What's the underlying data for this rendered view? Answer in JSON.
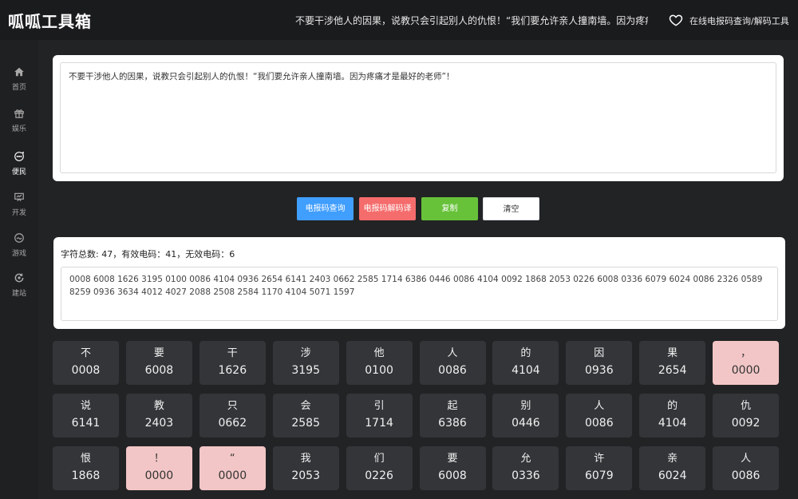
{
  "header": {
    "logo": "呱呱工具箱",
    "marquee": "不要干涉他人的因果，说教只会引起别人的仇恨！“我们要允许亲人撞南墙。因为疼痛才是:",
    "link": "在线电报码查询/解码工具"
  },
  "sidebar": {
    "items": [
      {
        "label": "首页",
        "icon": "home-icon"
      },
      {
        "label": "娱乐",
        "icon": "gift-icon"
      },
      {
        "label": "便民",
        "icon": "chat-icon"
      },
      {
        "label": "开发",
        "icon": "presentation-icon"
      },
      {
        "label": "游戏",
        "icon": "gamepad-icon"
      },
      {
        "label": "建站",
        "icon": "refresh-icon"
      }
    ],
    "active": "便民"
  },
  "input": {
    "value": "不要干涉他人的因果，说教只会引起别人的仇恨！“我们要允许亲人撞南墙。因为疼痛才是最好的老师”！"
  },
  "buttons": {
    "query": "电报码查询",
    "decode": "电报码解码译",
    "copy": "复制",
    "clear": "清空"
  },
  "result": {
    "summary": "字符总数: 47，有效电码：41，无效电码：6",
    "codes": "0008 6008 1626 3195 0100 0086 4104 0936 2654 6141 2403 0662 2585 1714 6386 0446 0086 4104 0092 1868 2053 0226 6008 0336 6079 6024 0086 2326 0589 8259 0936 3634 4012 4027 2088 2508 2584 1170 4104 5071 1597"
  },
  "cells": [
    {
      "ch": "不",
      "code": "0008",
      "invalid": false
    },
    {
      "ch": "要",
      "code": "6008",
      "invalid": false
    },
    {
      "ch": "干",
      "code": "1626",
      "invalid": false
    },
    {
      "ch": "涉",
      "code": "3195",
      "invalid": false
    },
    {
      "ch": "他",
      "code": "0100",
      "invalid": false
    },
    {
      "ch": "人",
      "code": "0086",
      "invalid": false
    },
    {
      "ch": "的",
      "code": "4104",
      "invalid": false
    },
    {
      "ch": "因",
      "code": "0936",
      "invalid": false
    },
    {
      "ch": "果",
      "code": "2654",
      "invalid": false
    },
    {
      "ch": "，",
      "code": "0000",
      "invalid": true
    },
    {
      "ch": "说",
      "code": "6141",
      "invalid": false
    },
    {
      "ch": "教",
      "code": "2403",
      "invalid": false
    },
    {
      "ch": "只",
      "code": "0662",
      "invalid": false
    },
    {
      "ch": "会",
      "code": "2585",
      "invalid": false
    },
    {
      "ch": "引",
      "code": "1714",
      "invalid": false
    },
    {
      "ch": "起",
      "code": "6386",
      "invalid": false
    },
    {
      "ch": "别",
      "code": "0446",
      "invalid": false
    },
    {
      "ch": "人",
      "code": "0086",
      "invalid": false
    },
    {
      "ch": "的",
      "code": "4104",
      "invalid": false
    },
    {
      "ch": "仇",
      "code": "0092",
      "invalid": false
    },
    {
      "ch": "恨",
      "code": "1868",
      "invalid": false
    },
    {
      "ch": "！",
      "code": "0000",
      "invalid": true
    },
    {
      "ch": "“",
      "code": "0000",
      "invalid": true
    },
    {
      "ch": "我",
      "code": "2053",
      "invalid": false
    },
    {
      "ch": "们",
      "code": "0226",
      "invalid": false
    },
    {
      "ch": "要",
      "code": "6008",
      "invalid": false
    },
    {
      "ch": "允",
      "code": "0336",
      "invalid": false
    },
    {
      "ch": "许",
      "code": "6079",
      "invalid": false
    },
    {
      "ch": "亲",
      "code": "6024",
      "invalid": false
    },
    {
      "ch": "人",
      "code": "0086",
      "invalid": false
    }
  ]
}
